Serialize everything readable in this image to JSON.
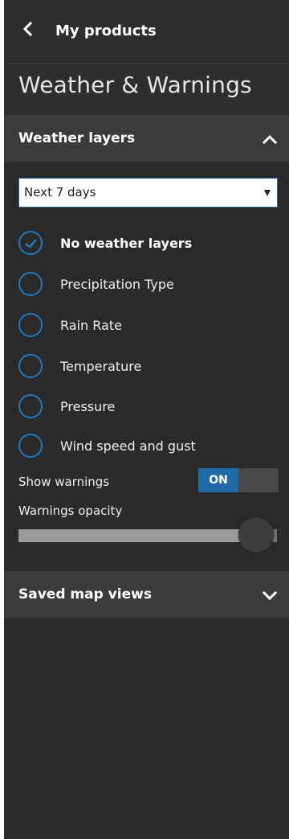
{
  "header": {
    "back_label": "My products",
    "title": "Weather & Warnings"
  },
  "weather_layers": {
    "header_label": "Weather layers",
    "time_select": {
      "value": "Next 7 days"
    },
    "options": [
      {
        "label": "No weather layers",
        "selected": true
      },
      {
        "label": "Precipitation Type",
        "selected": false
      },
      {
        "label": "Rain Rate",
        "selected": false
      },
      {
        "label": "Temperature",
        "selected": false
      },
      {
        "label": "Pressure",
        "selected": false
      },
      {
        "label": "Wind speed and gust",
        "selected": false
      }
    ],
    "show_warnings": {
      "label": "Show warnings",
      "state": "ON"
    },
    "warnings_opacity": {
      "label": "Warnings opacity",
      "value_fraction": 0.92
    }
  },
  "saved_map_views": {
    "header_label": "Saved map views"
  },
  "colors": {
    "accent": "#1e6aa8",
    "panel_bg": "#2a2a2a",
    "section_bg": "#3b3b3b"
  }
}
